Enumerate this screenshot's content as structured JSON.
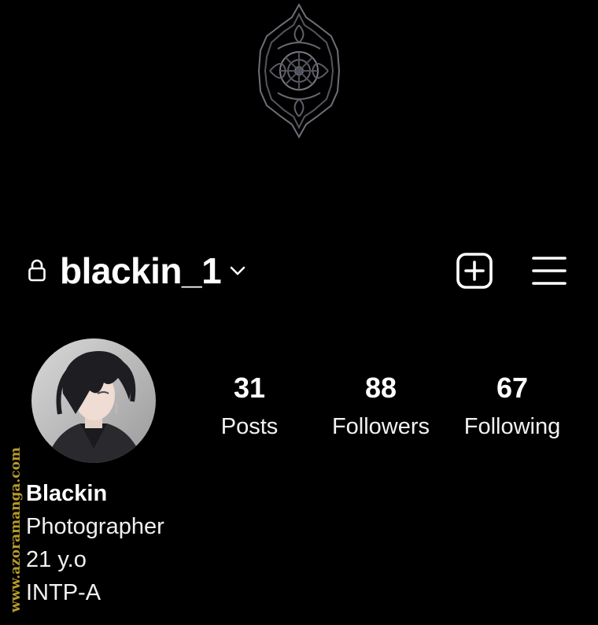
{
  "header": {
    "username": "blackin_1",
    "lock_icon": "lock-icon",
    "switch_icon": "chevron-down-icon",
    "create_icon": "plus-square-icon",
    "menu_icon": "hamburger-menu-icon"
  },
  "stats": {
    "posts": {
      "value": "31",
      "label": "Posts"
    },
    "followers": {
      "value": "88",
      "label": "Followers"
    },
    "following": {
      "value": "67",
      "label": "Following"
    }
  },
  "bio": {
    "name": "Blackin",
    "lines": [
      "Photographer",
      "21 y.o",
      "INTP-A"
    ]
  },
  "watermark": "www.azoramanga.com",
  "colors": {
    "background": "#000000",
    "text": "#ffffff",
    "watermark": "#b59b2a",
    "ornament": "#6f6f78"
  }
}
